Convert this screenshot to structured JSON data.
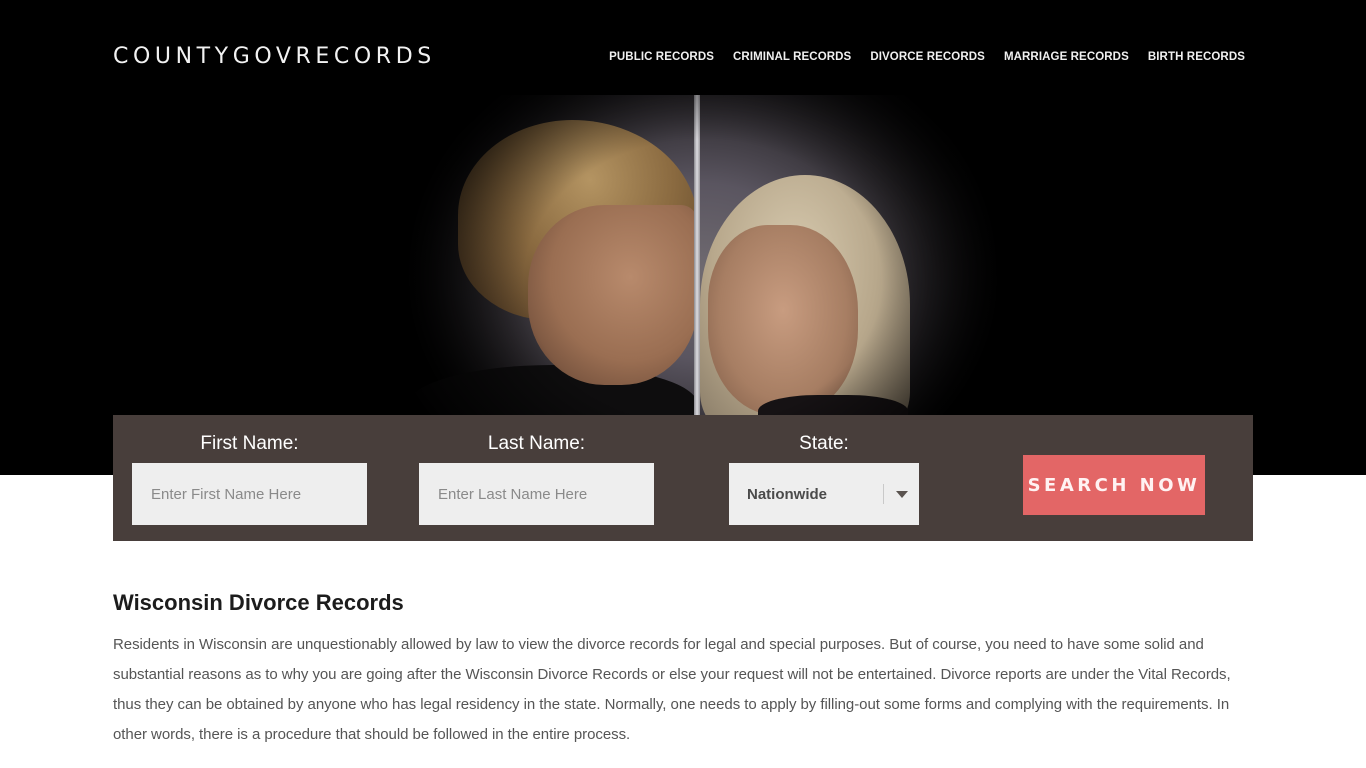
{
  "header": {
    "logo": "COUNTYGOVRECORDS",
    "nav": [
      {
        "label": "PUBLIC RECORDS"
      },
      {
        "label": "CRIMINAL RECORDS"
      },
      {
        "label": "DIVORCE RECORDS"
      },
      {
        "label": "MARRIAGE RECORDS"
      },
      {
        "label": "BIRTH RECORDS"
      }
    ]
  },
  "hero": {
    "image_description": "couple-separated-by-wall"
  },
  "search": {
    "first_name": {
      "label": "First Name:",
      "placeholder": "Enter First Name Here",
      "value": ""
    },
    "last_name": {
      "label": "Last Name:",
      "placeholder": "Enter Last Name Here",
      "value": ""
    },
    "state": {
      "label": "State:",
      "selected": "Nationwide",
      "icon": "chevron-down-icon"
    },
    "button_label": "SEARCH NOW",
    "colors": {
      "panel": "#483e3b",
      "button": "#e36666"
    }
  },
  "article": {
    "title": "Wisconsin Divorce Records",
    "body": "Residents in Wisconsin are unquestionably allowed by law to view the divorce records for legal and special purposes. But of course, you need to have some solid and substantial reasons as to why you are going after the Wisconsin Divorce Records or else your request will not be entertained. Divorce reports are under the Vital Records, thus they can be obtained by anyone who has legal residency in the state. Normally, one needs to apply by filling-out some forms and complying with the requirements. In other words, there is a procedure that should be followed in the entire process."
  }
}
